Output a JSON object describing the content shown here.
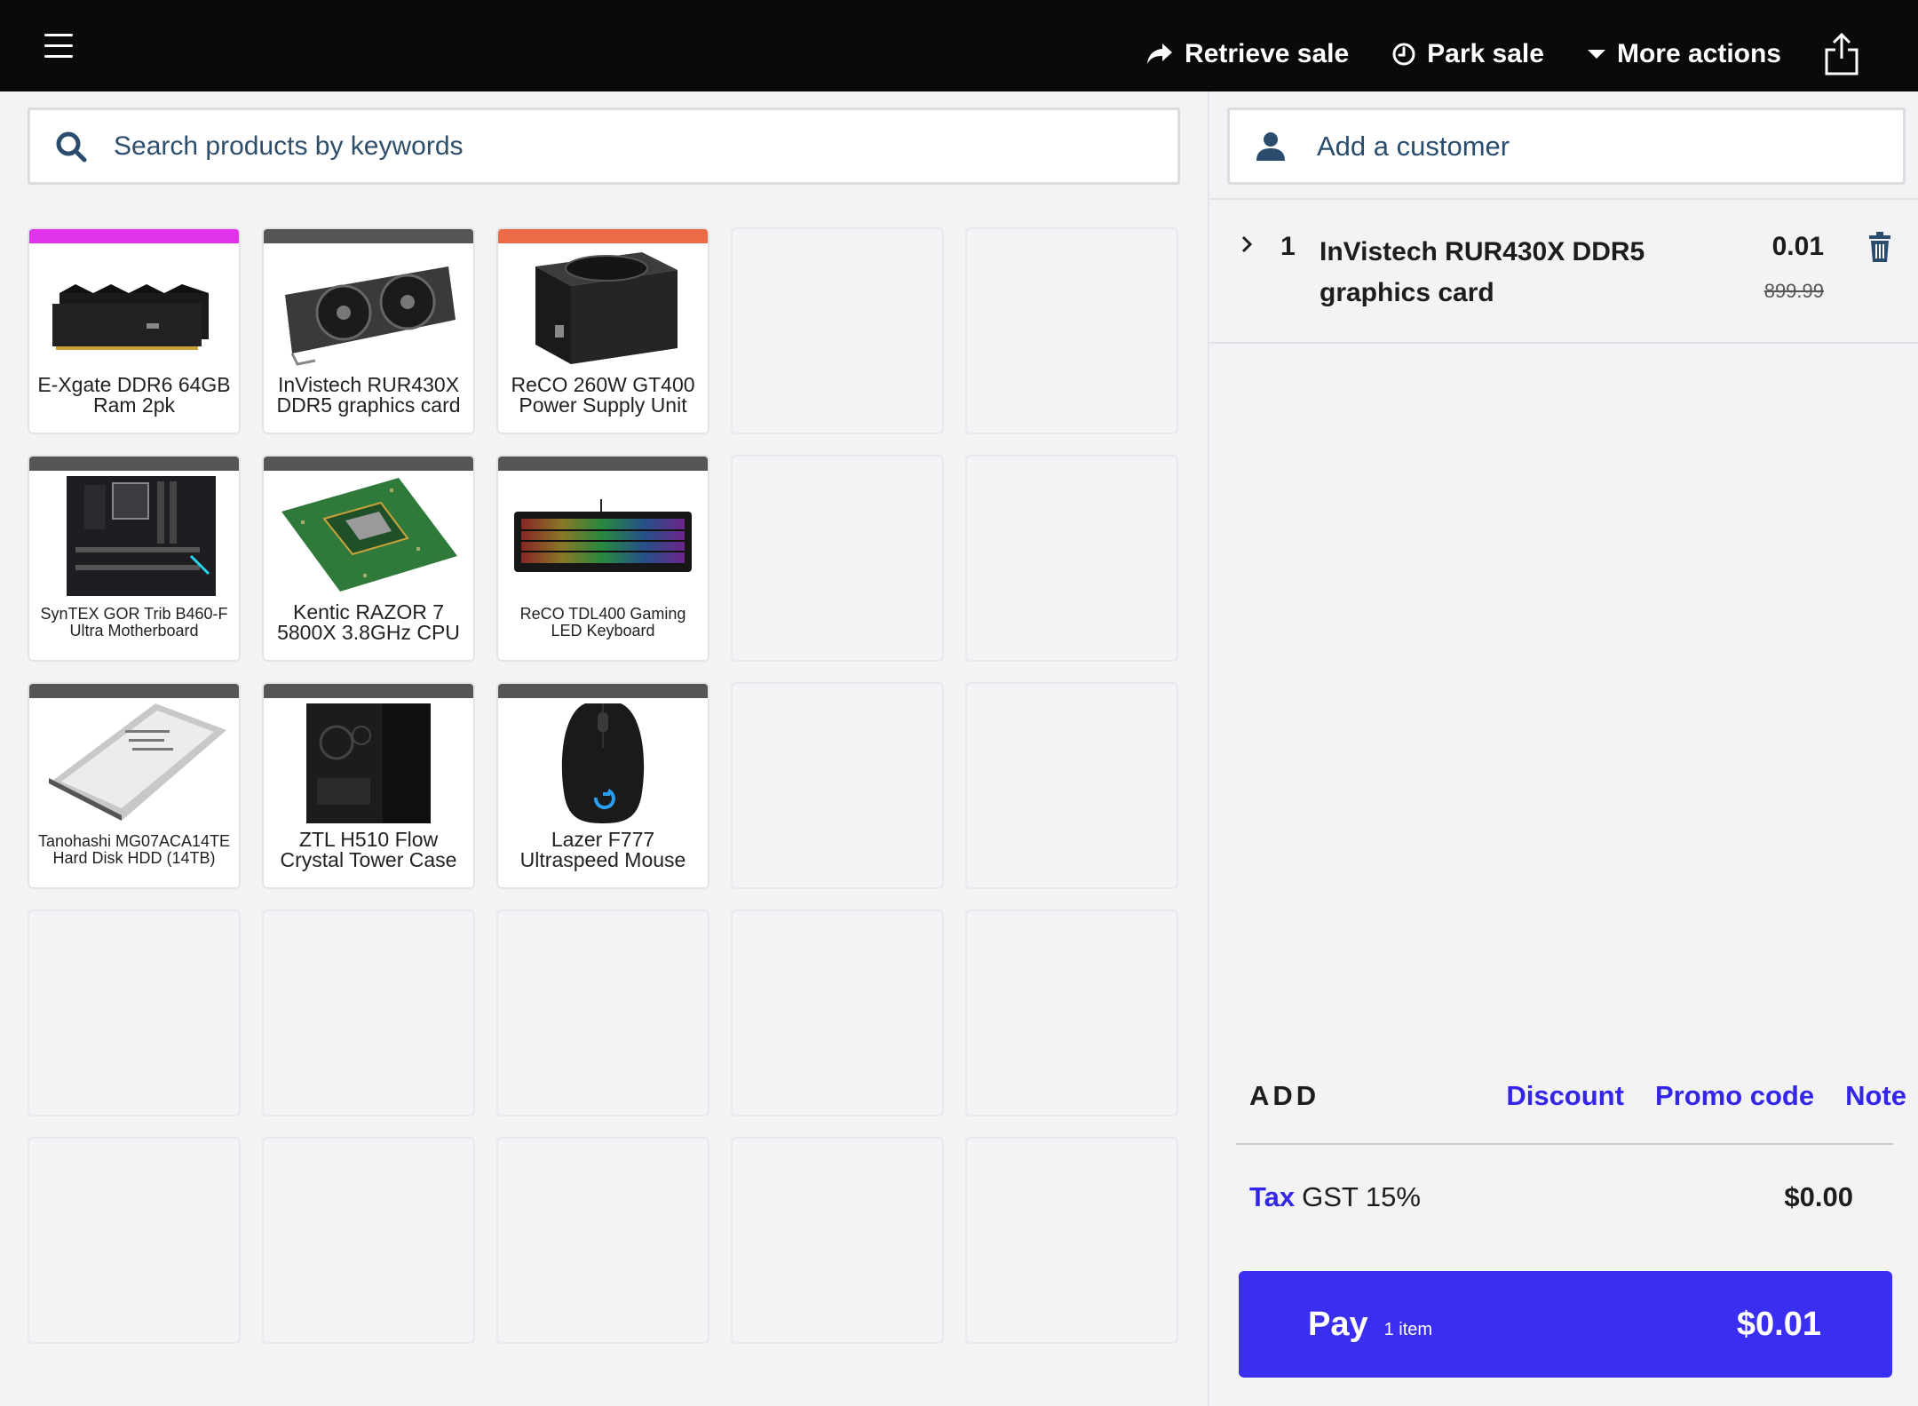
{
  "topbar": {
    "actions": [
      {
        "label": "Retrieve sale",
        "icon": "share-arrow-icon"
      },
      {
        "label": "Park sale",
        "icon": "clock-icon"
      },
      {
        "label": "More actions",
        "icon": "caret-down-icon"
      }
    ],
    "share_icon": "upload-icon"
  },
  "search": {
    "placeholder": "Search products by keywords"
  },
  "products": [
    {
      "name": "E-Xgate DDR6 64GB Ram 2pk",
      "color": "#e134e8",
      "icon": "ram-icon"
    },
    {
      "name": "InVistech RUR430X DDR5 graphics card",
      "color": "#555555",
      "icon": "gpu-icon"
    },
    {
      "name": "ReCO 260W GT400 Power Supply Unit",
      "color": "#ea6b45",
      "icon": "psu-icon"
    },
    {
      "name": "SynTEX GOR Trib B460-F Ultra Motherboard",
      "color": "#555555",
      "icon": "motherboard-icon"
    },
    {
      "name": "Kentic RAZOR 7 5800X 3.8GHz CPU",
      "color": "#555555",
      "icon": "cpu-icon"
    },
    {
      "name": "ReCO TDL400 Gaming LED Keyboard",
      "color": "#555555",
      "icon": "keyboard-icon"
    },
    {
      "name": "Tanohashi MG07ACA14TE Hard Disk HDD (14TB)",
      "color": "#555555",
      "icon": "hdd-icon"
    },
    {
      "name": "ZTL H510 Flow Crystal Tower Case",
      "color": "#555555",
      "icon": "case-icon"
    },
    {
      "name": "Lazer F777 Ultraspeed Mouse",
      "color": "#555555",
      "icon": "mouse-icon"
    }
  ],
  "customer": {
    "label": "Add a customer"
  },
  "cart": {
    "items": [
      {
        "qty": "1",
        "name": "InVistech RUR430X DDR5 graphics card",
        "price": "0.01",
        "original_price": "899.99"
      }
    ]
  },
  "add": {
    "label": "ADD",
    "links": [
      "Discount",
      "Promo code",
      "Note"
    ]
  },
  "tax": {
    "link": "Tax",
    "label": "GST 15%",
    "amount": "$0.00"
  },
  "pay": {
    "label": "Pay",
    "count": "1 item",
    "amount": "$0.01"
  },
  "colors": {
    "accent": "#3a2ff0",
    "link": "#3326e8",
    "topbar": "#0a0a0a"
  }
}
